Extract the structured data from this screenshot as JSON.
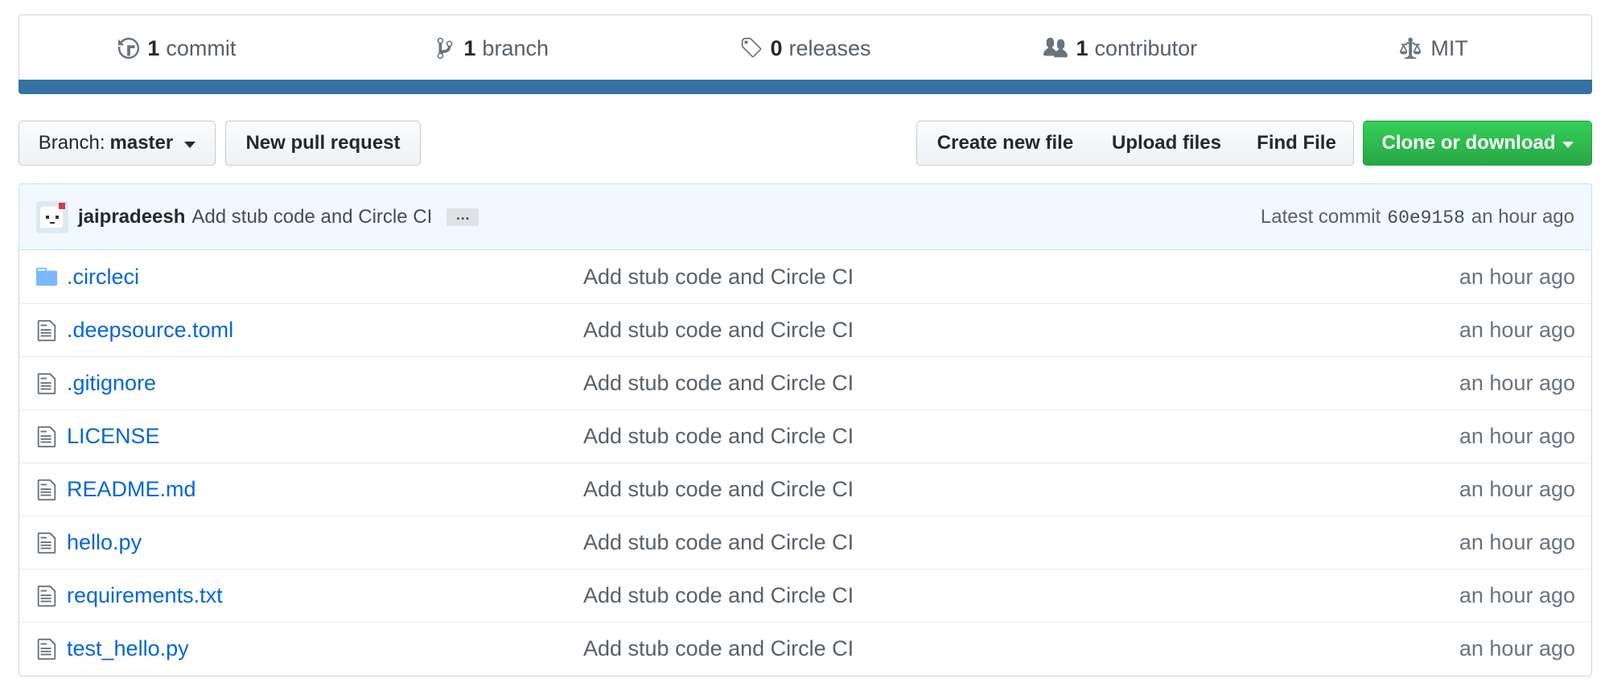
{
  "summary": {
    "commits": {
      "count": "1",
      "label": "commit"
    },
    "branches": {
      "count": "1",
      "label": "branch"
    },
    "releases": {
      "count": "0",
      "label": "releases"
    },
    "contributors": {
      "count": "1",
      "label": "contributor"
    },
    "license": {
      "label": "MIT"
    },
    "language_bar_color": "#3572a5"
  },
  "toolbar": {
    "branch_prefix": "Branch:",
    "branch_name": "master",
    "new_pull_request": "New pull request",
    "create_new_file": "Create new file",
    "upload_files": "Upload files",
    "find_file": "Find File",
    "clone_or_download": "Clone or download"
  },
  "latest_commit": {
    "author": "jaipradeesh",
    "message": "Add stub code and Circle CI",
    "ellipsis": "…",
    "prefix": "Latest commit",
    "sha": "60e9158",
    "age": "an hour ago"
  },
  "files": [
    {
      "type": "folder",
      "name": ".circleci",
      "message": "Add stub code and Circle CI",
      "age": "an hour ago"
    },
    {
      "type": "file",
      "name": ".deepsource.toml",
      "message": "Add stub code and Circle CI",
      "age": "an hour ago"
    },
    {
      "type": "file",
      "name": ".gitignore",
      "message": "Add stub code and Circle CI",
      "age": "an hour ago"
    },
    {
      "type": "file",
      "name": "LICENSE",
      "message": "Add stub code and Circle CI",
      "age": "an hour ago"
    },
    {
      "type": "file",
      "name": "README.md",
      "message": "Add stub code and Circle CI",
      "age": "an hour ago"
    },
    {
      "type": "file",
      "name": "hello.py",
      "message": "Add stub code and Circle CI",
      "age": "an hour ago"
    },
    {
      "type": "file",
      "name": "requirements.txt",
      "message": "Add stub code and Circle CI",
      "age": "an hour ago"
    },
    {
      "type": "file",
      "name": "test_hello.py",
      "message": "Add stub code and Circle CI",
      "age": "an hour ago"
    }
  ],
  "colors": {
    "link": "#0366d6",
    "clone_button": "#28a745",
    "commit_tease_bg": "#f1f8ff"
  }
}
